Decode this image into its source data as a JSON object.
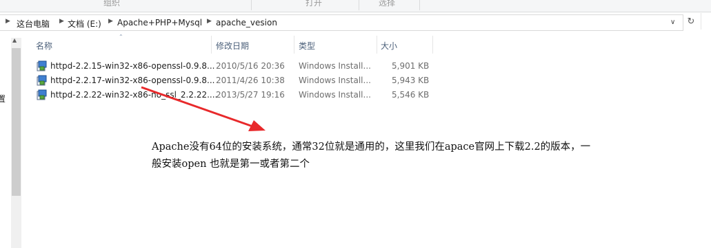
{
  "ribbon": {
    "groups": [
      "组织",
      "打开",
      "选择"
    ]
  },
  "address_bar": {
    "crumbs": [
      "这台电脑",
      "文档 (E:)",
      "Apache+PHP+Mysql",
      "apache_vesion"
    ]
  },
  "nav_pane": {
    "partial_text": "置"
  },
  "columns": {
    "name": "名称",
    "date": "修改日期",
    "type": "类型",
    "size": "大小"
  },
  "files": [
    {
      "name": "httpd-2.2.15-win32-x86-openssl-0.9.8...",
      "date": "2010/5/16 20:36",
      "type": "Windows Install...",
      "size": "5,901 KB"
    },
    {
      "name": "httpd-2.2.17-win32-x86-openssl-0.9.8...",
      "date": "2011/4/26 10:38",
      "type": "Windows Install...",
      "size": "5,943 KB"
    },
    {
      "name": "httpd-2.2.22-win32-x86-no_ssl_2.2.22....",
      "date": "2013/5/27 19:16",
      "type": "Windows Install...",
      "size": "5,546 KB"
    }
  ],
  "annotation": {
    "line1": "Apache没有64位的安装系统，通常32位就是通用的，这里我们在apace官网上下载2.2的版本，一",
    "line2": "般安装open 也就是第一或者第二个",
    "arrow_color": "#e8292b"
  }
}
